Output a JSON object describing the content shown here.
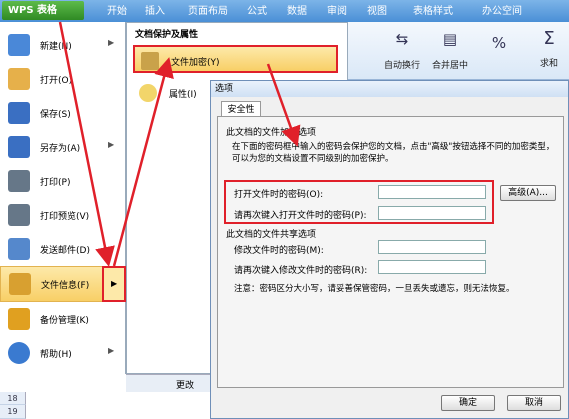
{
  "ribbon": {
    "app_button": "WPS 表格",
    "tabs": [
      "开始",
      "插入",
      "页面布局",
      "公式",
      "数据",
      "审阅",
      "视图",
      "表格样式",
      "办公空间"
    ],
    "tools": [
      {
        "icon": "wrap-text-icon",
        "label": "自动换行"
      },
      {
        "icon": "merge-center-icon",
        "label": "合并居中"
      },
      {
        "icon": "percent-icon",
        "label": "%"
      },
      {
        "icon": "sum-icon",
        "label": "求和"
      }
    ]
  },
  "menu": {
    "items": [
      {
        "label": "新建(N)",
        "icon": "new-doc-icon",
        "color": "#4a88d8",
        "has_arrow": true
      },
      {
        "label": "打开(O)",
        "icon": "folder-icon",
        "color": "#e6b04a",
        "has_arrow": false
      },
      {
        "label": "保存(S)",
        "icon": "save-icon",
        "color": "#3a6fc2",
        "has_arrow": false
      },
      {
        "label": "另存为(A)",
        "icon": "save-as-icon",
        "color": "#3a6fc2",
        "has_arrow": true
      },
      {
        "label": "打印(P)",
        "icon": "printer-icon",
        "color": "#667788",
        "has_arrow": false
      },
      {
        "label": "打印预览(V)",
        "icon": "print-preview-icon",
        "color": "#667788",
        "has_arrow": false
      },
      {
        "label": "发送邮件(D)",
        "icon": "mail-icon",
        "color": "#5588cc",
        "has_arrow": false
      },
      {
        "label": "文件信息(F)",
        "icon": "file-info-icon",
        "color": "#d8a030",
        "has_arrow": true
      },
      {
        "label": "备份管理(K)",
        "icon": "backup-icon",
        "color": "#e0a020",
        "has_arrow": false
      },
      {
        "label": "帮助(H)",
        "icon": "help-icon",
        "color": "#3a7ad0",
        "has_arrow": true
      }
    ]
  },
  "submenu": {
    "title": "文档保护及属性",
    "items": [
      {
        "label": "文件加密(Y)",
        "icon": "encrypt-icon"
      },
      {
        "label": "属性(I)",
        "icon": "properties-icon"
      }
    ]
  },
  "sheet": {
    "rows": [
      "18",
      "19"
    ],
    "toolbar_fragment": "更改"
  },
  "dialog": {
    "title": "选项",
    "tab": "安全性",
    "section1_title": "此文档的文件加密选项",
    "section1_desc": "在下面的密码框中输入的密码会保护您的文档，点击\"高级\"按钮选择不同的加密类型，可以为您的文档设置不同级别的加密保护。",
    "open_password_label": "打开文件时的密码(O):",
    "open_password_value": "",
    "reenter_open_label": "请再次键入打开文件时的密码(P):",
    "reenter_open_value": "",
    "advanced_button": "高级(A)...",
    "section2_title": "此文档的文件共享选项",
    "modify_password_label": "修改文件时的密码(M):",
    "modify_password_value": "",
    "reenter_modify_label": "请再次键入修改文件时的密码(R):",
    "reenter_modify_value": "",
    "note": "注意：密码区分大小写，请妥善保管密码，一旦丢失或遗忘，则无法恢复。",
    "ok_button": "确定",
    "cancel_button": "取消"
  },
  "colors": {
    "annotation": "#e0202a",
    "selection": "#f8cf66"
  }
}
